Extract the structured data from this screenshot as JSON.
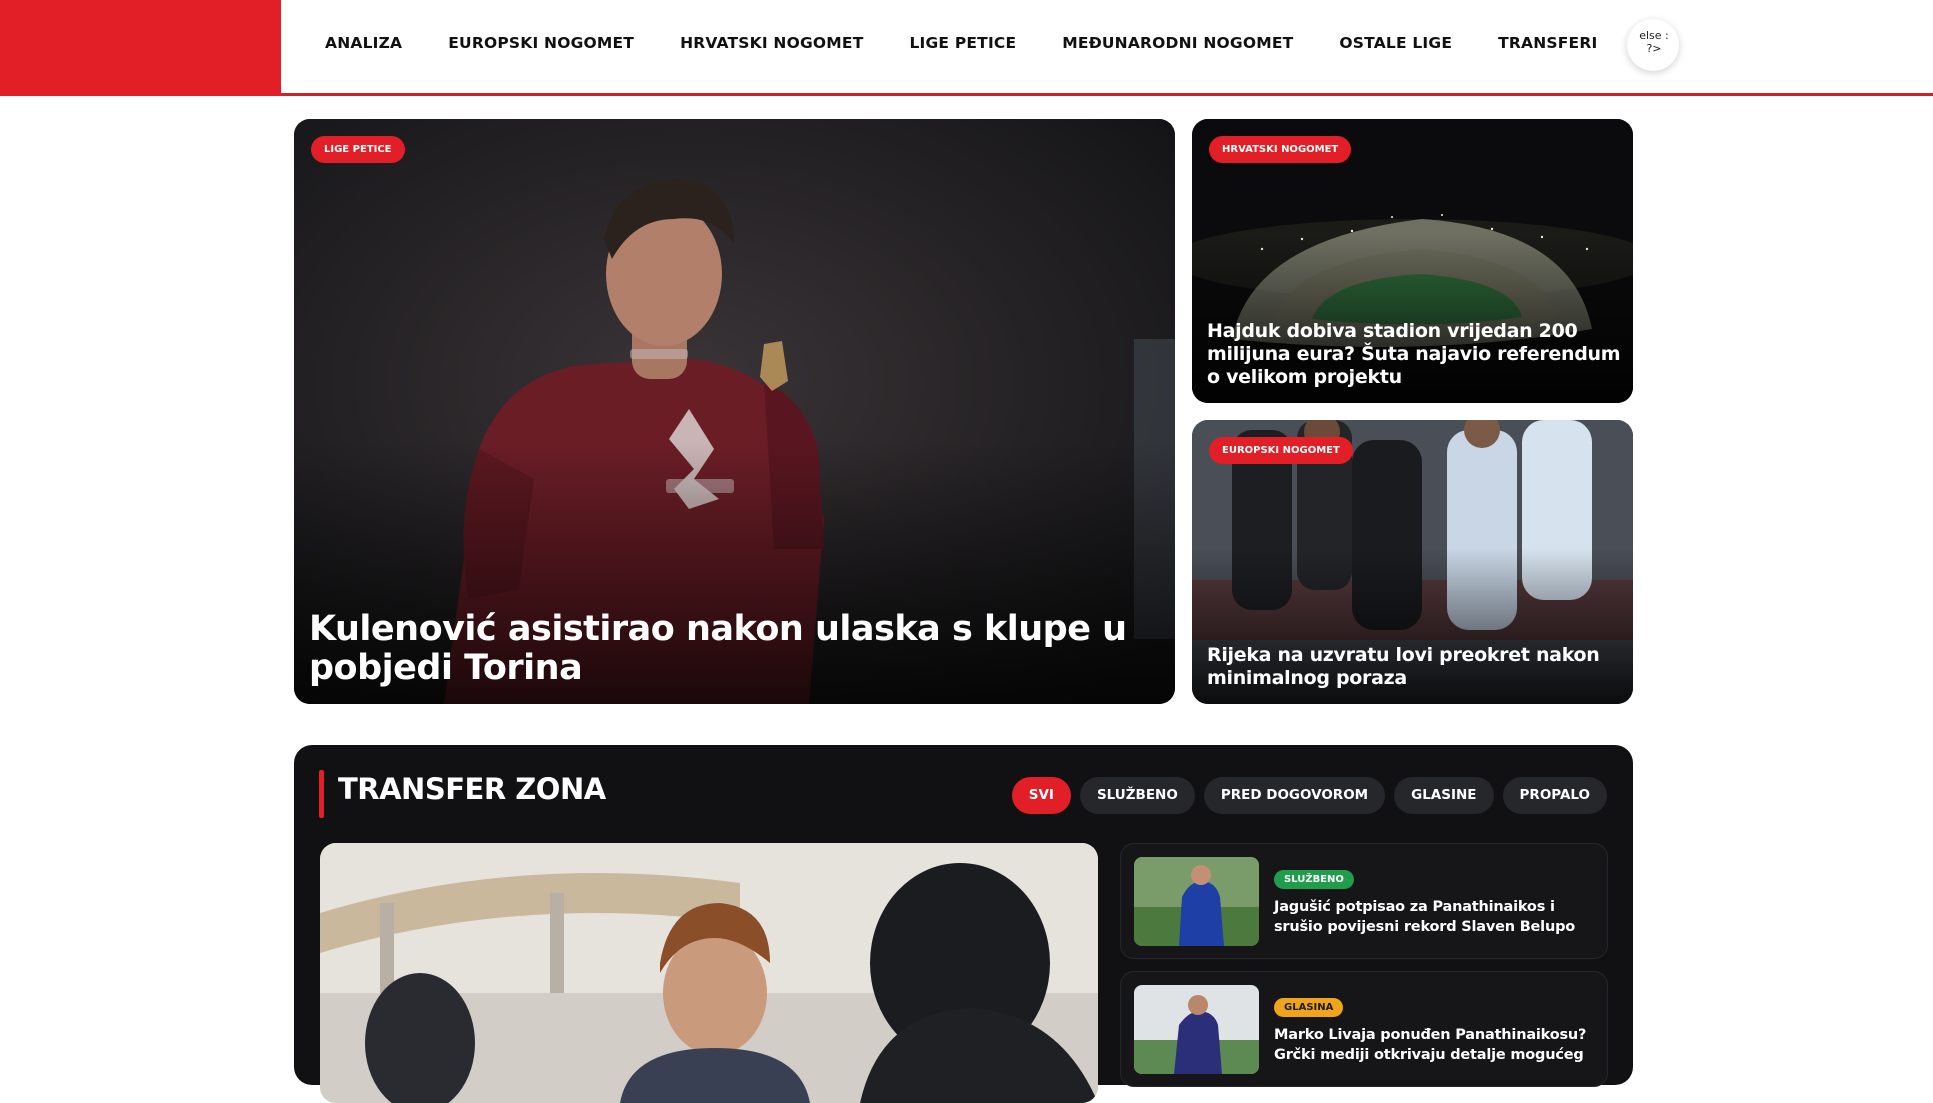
{
  "nav": {
    "items": [
      {
        "label": "ANALIZA"
      },
      {
        "label": "EUROPSKI NOGOMET"
      },
      {
        "label": "HRVATSKI NOGOMET"
      },
      {
        "label": "LIGE PETICE"
      },
      {
        "label": "MEĐUNARODNI NOGOMET"
      },
      {
        "label": "OSTALE LIGE"
      },
      {
        "label": "TRANSFERI"
      }
    ],
    "toggle_text_1": "else :",
    "toggle_text_2": "?>"
  },
  "hero": {
    "main": {
      "category": "LIGE PETICE",
      "title": "Kulenović asistirao nakon ulaska s klupe u pobjedi Torina"
    },
    "side1": {
      "category": "HRVATSKI NOGOMET",
      "title": "Hajduk dobiva stadion vrijedan 200 milijuna eura? Šuta najavio referendum o velikom projektu"
    },
    "side2": {
      "category": "EUROPSKI NOGOMET",
      "title": "Rijeka na uzvratu lovi preokret nakon minimalnog poraza"
    }
  },
  "transfer_zona": {
    "title": "TRANSFER ZONA",
    "filters": [
      {
        "label": "SVI",
        "active": true
      },
      {
        "label": "SLUŽBENO",
        "active": false
      },
      {
        "label": "PRED DOGOVOROM",
        "active": false
      },
      {
        "label": "GLASINE",
        "active": false
      },
      {
        "label": "PROPALO",
        "active": false
      }
    ],
    "items": [
      {
        "tag": "SLUŽBENO",
        "title": "Jagušić potpisao za Panathinaikos i srušio povijesni rekord Slaven Belupo"
      },
      {
        "tag": "GLASINA",
        "title": "Marko Livaja ponuđen Panathinaikosu? Grčki mediji otkrivaju detalje mogućeg"
      }
    ]
  },
  "colors": {
    "brand_red": "#e21f26",
    "tag_official": "#1f9d4c",
    "tag_rumor": "#f0a41b",
    "panel_dark": "#111113"
  }
}
